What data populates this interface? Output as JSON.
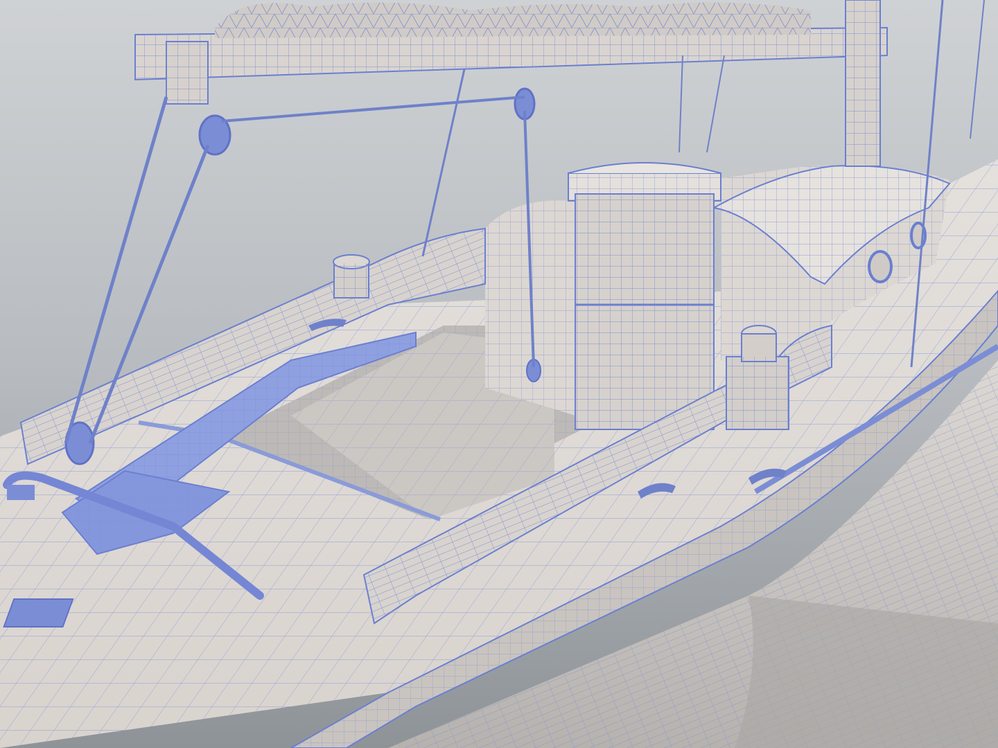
{
  "scene": {
    "subject": "sailboat-cockpit-wireframe-render",
    "colors": {
      "background_light": "#d4d7da",
      "background_dark": "#8f949a",
      "surface": "#e2ddd8",
      "surface_shadow": "#b9b6b4",
      "wire": "#6a7fd0",
      "rope": "#6f81c9",
      "hardware": "#7b8dd4"
    },
    "icons": {
      "winch": "winch-icon",
      "cleat": "cleat-icon",
      "block": "pulley-block-icon",
      "porthole": "porthole-icon"
    }
  }
}
